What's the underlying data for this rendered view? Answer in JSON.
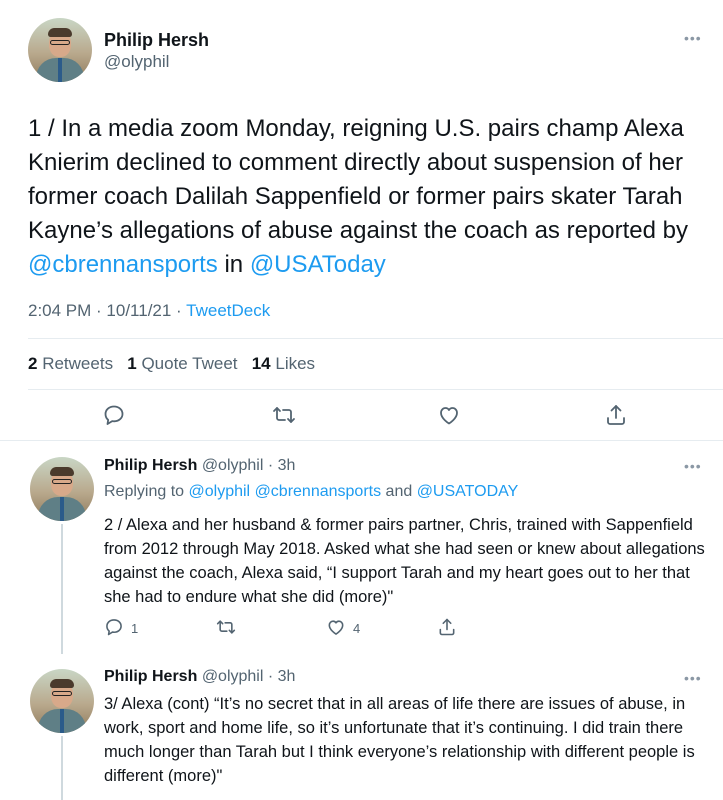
{
  "main_tweet": {
    "author_name": "Philip Hersh",
    "author_handle": "@olyphil",
    "text_before": "1 / In a media zoom Monday, reigning U.S. pairs champ Alexa Knierim declined to comment directly about suspension of her former coach Dalilah Sappenfield or former pairs skater Tarah Kayne’s allegations of abuse against the coach as reported by ",
    "mention_1": "@cbrennansports",
    "text_middle": " in ",
    "mention_2": "@USAToday",
    "time": "2:04 PM · 10/11/21 · ",
    "source": "TweetDeck",
    "retweets_count": "2",
    "retweets_label": "Retweets",
    "quotes_count": "1",
    "quotes_label": "Quote Tweet",
    "likes_count": "14",
    "likes_label": "Likes"
  },
  "replies": [
    {
      "author_name": "Philip Hersh",
      "author_handle": "@olyphil",
      "age": " · 3h",
      "replying_label": "Replying to ",
      "replying_to_1": "@olyphil",
      "replying_to_2": "@cbrennansports",
      "replying_and": " and ",
      "replying_to_3": "@USATODAY",
      "text": "2 / Alexa and her husband & former pairs partner, Chris, trained with Sappenfield from 2012 through May 2018. Asked what she had seen or knew about allegations against the coach, Alexa said, “I support Tarah and my heart goes out to her that she had to endure what she did (more)\"",
      "reply_count": "1",
      "like_count": "4"
    },
    {
      "author_name": "Philip Hersh",
      "author_handle": "@olyphil",
      "age": " · 3h",
      "text": "3/ Alexa (cont) “It’s no secret that in all areas of life there are issues of abuse, in work, sport and home life, so it’s unfortunate that it’s continuing. I did train there much longer than Tarah but I think everyone’s relationship with different people is different (more)\""
    }
  ],
  "icons": {
    "more": "more-icon",
    "reply": "reply-icon",
    "retweet": "retweet-icon",
    "like": "heart-icon",
    "share": "share-icon"
  },
  "colors": {
    "link": "#1d9bf0",
    "secondary_text": "#536471",
    "icon": "#536471",
    "divider": "#e6ecf0",
    "thread_line": "#cfd9de"
  }
}
